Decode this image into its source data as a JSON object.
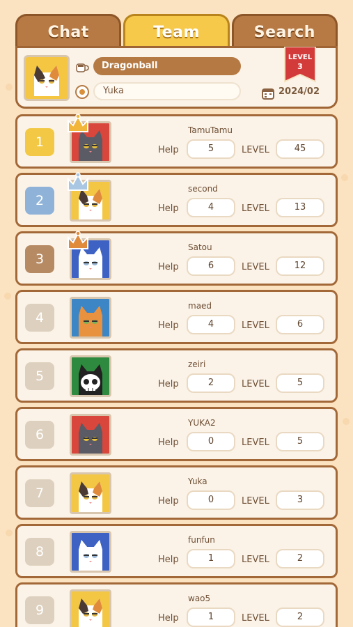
{
  "tabs": [
    {
      "label": "Chat",
      "active": false
    },
    {
      "label": "Team",
      "active": true
    },
    {
      "label": "Search",
      "active": false
    }
  ],
  "team": {
    "name": "Dragonball",
    "leader": "Yuka",
    "level_label": "LEVEL",
    "level_value": "3",
    "date": "2024/02"
  },
  "labels": {
    "help": "Help",
    "level": "LEVEL"
  },
  "members": [
    {
      "rank": "1",
      "name": "TamuTamu",
      "help": "5",
      "level": "45",
      "avatar_bg": "#d8463c",
      "cat": "gray",
      "crown": "gold"
    },
    {
      "rank": "2",
      "name": "second",
      "help": "4",
      "level": "13",
      "avatar_bg": "#f3c744",
      "cat": "calico",
      "crown": "silver"
    },
    {
      "rank": "3",
      "name": "Satou",
      "help": "6",
      "level": "12",
      "avatar_bg": "#3e62c4",
      "cat": "white",
      "crown": "bronze"
    },
    {
      "rank": "4",
      "name": "maed",
      "help": "4",
      "level": "6",
      "avatar_bg": "#3c86c6",
      "cat": "orange",
      "crown": ""
    },
    {
      "rank": "5",
      "name": "zeiri",
      "help": "2",
      "level": "5",
      "avatar_bg": "#2e8a3e",
      "cat": "skull",
      "crown": ""
    },
    {
      "rank": "6",
      "name": "YUKA2",
      "help": "0",
      "level": "5",
      "avatar_bg": "#d8463c",
      "cat": "gray",
      "crown": ""
    },
    {
      "rank": "7",
      "name": "Yuka",
      "help": "0",
      "level": "3",
      "avatar_bg": "#f3c744",
      "cat": "calico",
      "crown": ""
    },
    {
      "rank": "8",
      "name": "funfun",
      "help": "1",
      "level": "2",
      "avatar_bg": "#3e62c4",
      "cat": "white",
      "crown": ""
    },
    {
      "rank": "9",
      "name": "wao5",
      "help": "1",
      "level": "2",
      "avatar_bg": "#f3c744",
      "cat": "calico",
      "crown": ""
    }
  ],
  "colors": {
    "accent": "#f7c94b",
    "brown": "#a36838",
    "panel": "#fbf3e8",
    "banner": "#d33b3b"
  }
}
